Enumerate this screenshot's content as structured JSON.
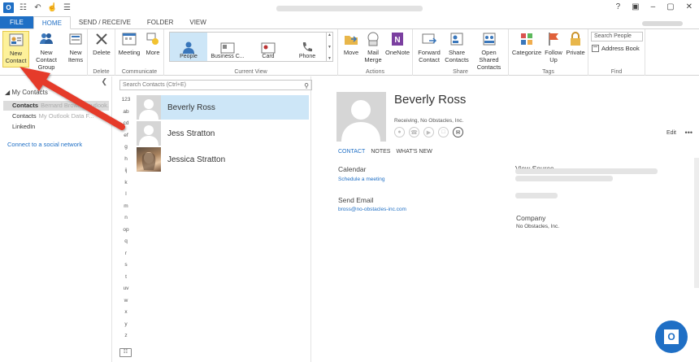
{
  "window": {
    "controls": [
      "?",
      "▣",
      "–",
      "▢",
      "✕"
    ]
  },
  "tabs": [
    "FILE",
    "HOME",
    "SEND / RECEIVE",
    "FOLDER",
    "VIEW"
  ],
  "ribbon": {
    "new": {
      "new_contact": "New Contact",
      "new_contact_group": "New Contact Group",
      "new_items": "New Items",
      "label": ""
    },
    "delete": {
      "delete": "Delete",
      "label": "Delete"
    },
    "communicate": {
      "meeting": "Meeting",
      "more": "More",
      "label": "Communicate"
    },
    "current_view": {
      "items": [
        "People",
        "Business C...",
        "Card",
        "Phone"
      ],
      "selected": "People",
      "label": "Current View"
    },
    "actions": {
      "move": "Move",
      "mail_merge": "Mail Merge",
      "onenote": "OneNote",
      "label": "Actions"
    },
    "share": {
      "forward_contact": "Forward Contact",
      "share_contacts": "Share Contacts",
      "open_shared_contacts": "Open Shared Contacts",
      "label": "Share"
    },
    "tags": {
      "categorize": "Categorize",
      "follow_up": "Follow Up",
      "private": "Private",
      "label": "Tags"
    },
    "find": {
      "search_people_placeholder": "Search People",
      "address_book": "Address Book",
      "label": "Find"
    }
  },
  "nav": {
    "header": "My Contacts",
    "items": [
      {
        "label": "Contacts",
        "sub": "Bernard Brown@outlook..."
      },
      {
        "label": "Contacts",
        "sub": "My Outlook Data F..."
      },
      {
        "label": "LinkedIn",
        "sub": ""
      }
    ],
    "social_link": "Connect to a social network"
  },
  "list": {
    "search_placeholder": "Search Contacts (Ctrl+E)",
    "alphabet": [
      "123",
      "ab",
      "cd",
      "ef",
      "g",
      "h",
      "ij",
      "k",
      "l",
      "m",
      "n",
      "op",
      "q",
      "r",
      "s",
      "t",
      "uv",
      "w",
      "x",
      "y",
      "z"
    ],
    "contacts": [
      {
        "name": "Beverly Ross",
        "photo": false
      },
      {
        "name": "Jess Stratton",
        "photo": false
      },
      {
        "name": "Jessica Stratton",
        "photo": true
      }
    ],
    "selected": "Beverly Ross"
  },
  "detail": {
    "name": "Beverly Ross",
    "subtitle": "Receiving, No Obstacles, Inc.",
    "edit_label": "Edit",
    "more_label": "•••",
    "tabs": [
      "CONTACT",
      "NOTES",
      "WHAT'S NEW"
    ],
    "calendar": {
      "heading": "Calendar",
      "value": "Schedule a meeting"
    },
    "send_email": {
      "heading": "Send Email",
      "value": "bross@no-obstacles-inc.com"
    },
    "view_source": {
      "heading": "View Source"
    },
    "company": {
      "heading": "Company",
      "value": "No Obstacles, Inc."
    }
  },
  "badge": {
    "letter": "O",
    "text": "Outlook"
  },
  "colors": {
    "accent": "#1f6fc5",
    "selection": "#cde6f7",
    "highlight": "#fdf19a",
    "annotation_arrow": "#e53b2c"
  }
}
